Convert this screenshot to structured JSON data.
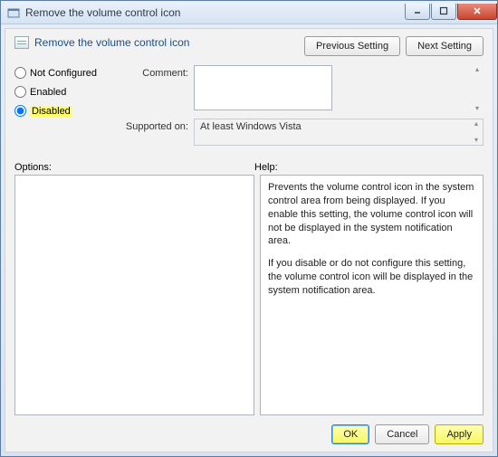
{
  "window": {
    "title": "Remove the volume control icon"
  },
  "header": {
    "title": "Remove the volume control icon",
    "prev": "Previous Setting",
    "next": "Next Setting"
  },
  "config": {
    "not_configured": "Not Configured",
    "enabled": "Enabled",
    "disabled": "Disabled",
    "selected": "disabled",
    "comment_label": "Comment:",
    "comment_value": "",
    "supported_label": "Supported on:",
    "supported_value": "At least Windows Vista"
  },
  "mid": {
    "options_label": "Options:",
    "help_label": "Help:"
  },
  "help": {
    "p1": "Prevents the volume control icon in the system control area from being displayed. If you enable this setting, the volume control icon will not be displayed in the system notification area.",
    "p2": "If you disable or do not configure this setting, the volume control icon will be displayed in the system notification area."
  },
  "footer": {
    "ok": "OK",
    "cancel": "Cancel",
    "apply": "Apply"
  }
}
